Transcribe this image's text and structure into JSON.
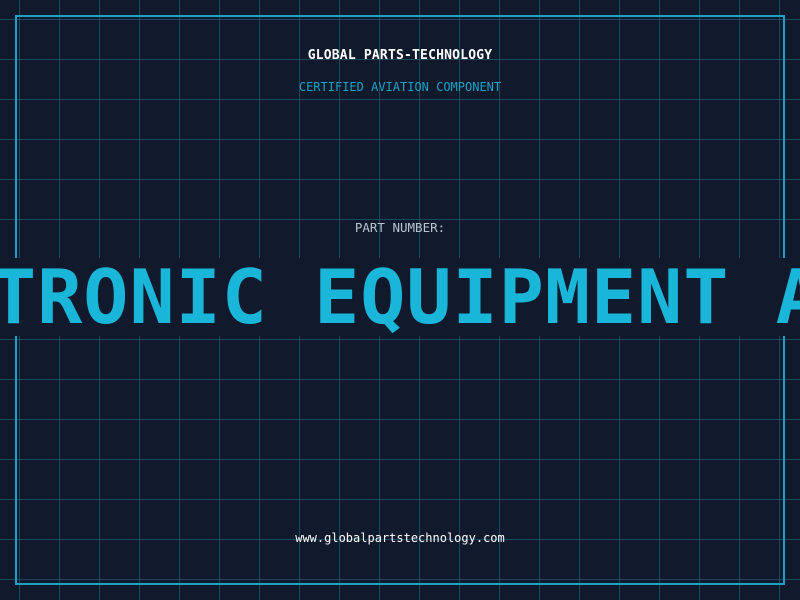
{
  "header": {
    "company_name": "GLOBAL PARTS-TECHNOLOGY",
    "subtitle": "CERTIFIED AVIATION COMPONENT"
  },
  "part": {
    "label": "PART NUMBER:",
    "value_visible": "TRONIC EQUIPMENT A"
  },
  "footer": {
    "url": "www.globalpartstechnology.com"
  },
  "colors": {
    "background": "#111a2d",
    "accent": "#19a3c4",
    "grid": "#236e82",
    "part_text": "#19b6d9"
  }
}
